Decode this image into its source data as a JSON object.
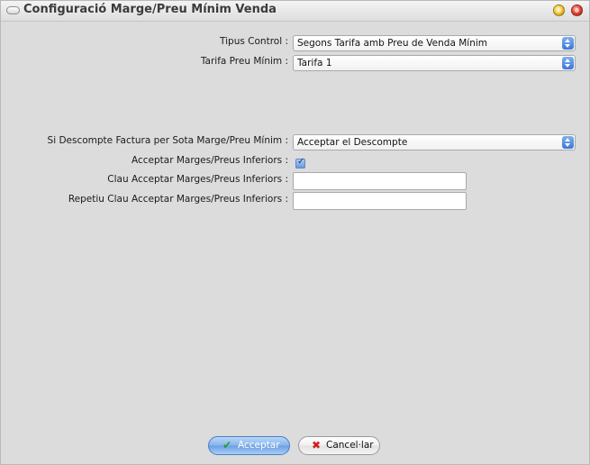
{
  "window": {
    "title": "Configuració Marge/Preu Mínim Venda",
    "minimize_icon": "minimize-icon",
    "close_icon": "close-icon",
    "accent_yellow": "#f7c93a",
    "accent_red": "#e84b3a"
  },
  "form": {
    "tipus_control": {
      "label": "Tipus Control :",
      "value": "Segons Tarifa amb Preu de Venda Mínim"
    },
    "tarifa_preu_minim": {
      "label": "Tarifa Preu Mínim :",
      "value": "Tarifa 1"
    },
    "descompte_factura": {
      "label": "Si Descompte Factura per Sota Marge/Preu Mínim :",
      "value": "Acceptar el Descompte"
    },
    "acceptar_inferiors": {
      "label": "Acceptar Marges/Preus Inferiors :",
      "checked": true
    },
    "clau": {
      "label": "Clau Acceptar Marges/Preus Inferiors :",
      "value": ""
    },
    "repetiu_clau": {
      "label": "Repetiu Clau Acceptar Marges/Preus Inferiors :",
      "value": ""
    }
  },
  "footer": {
    "accept_label": "Acceptar",
    "cancel_label": "Cancel·lar",
    "accept_icon": "checkmark-icon",
    "cancel_icon": "x-icon",
    "accept_color": "#86b4ec"
  }
}
